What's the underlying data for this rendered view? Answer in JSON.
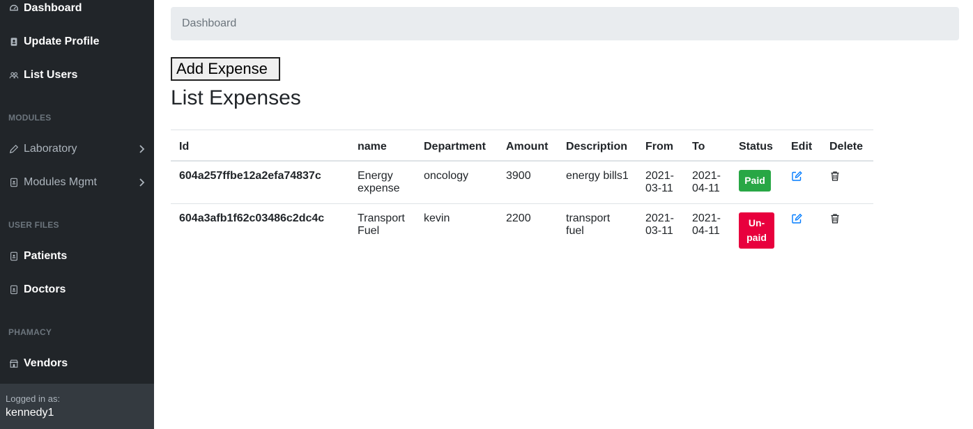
{
  "sidebar": {
    "items": [
      {
        "label": "Dashboard",
        "icon": "dashboard-icon"
      },
      {
        "label": "Update Profile",
        "icon": "profile-icon"
      },
      {
        "label": "List Users",
        "icon": "users-icon"
      },
      {
        "label": "Laboratory",
        "icon": "pen-icon"
      },
      {
        "label": "Modules Mgmt",
        "icon": "file-icon"
      },
      {
        "label": "Patients",
        "icon": "file-icon"
      },
      {
        "label": "Doctors",
        "icon": "file-icon"
      },
      {
        "label": "Vendors",
        "icon": "store-icon"
      }
    ],
    "sections": {
      "modules": "MODULES",
      "user_files": "USER FILES",
      "pharmacy": "PHAMACY"
    },
    "footer": {
      "logged_label": "Logged in as:",
      "username": "kennedy1"
    }
  },
  "breadcrumb": "Dashboard",
  "add_button": "Add Expense",
  "page_title": "List Expenses",
  "table": {
    "headers": [
      "Id",
      "name",
      "Department",
      "Amount",
      "Description",
      "From",
      "To",
      "Status",
      "Edit",
      "Delete"
    ],
    "rows": [
      {
        "id": "604a257ffbe12a2efa74837c",
        "name": "Energy expense",
        "department": "oncology",
        "amount": "3900",
        "description": "energy bills1",
        "from": "2021-03-11",
        "to": "2021-04-11",
        "status": "Paid"
      },
      {
        "id": "604a3afb1f62c03486c2dc4c",
        "name": "Transport Fuel",
        "department": "kevin",
        "amount": "2200",
        "description": "transport fuel",
        "from": "2021-03-11",
        "to": "2021-04-11",
        "status": "Un-paid"
      }
    ]
  },
  "colors": {
    "sidebar_bg": "#212529",
    "paid": "#28a745",
    "unpaid": "#e8003d",
    "edit_icon": "#007bff"
  }
}
